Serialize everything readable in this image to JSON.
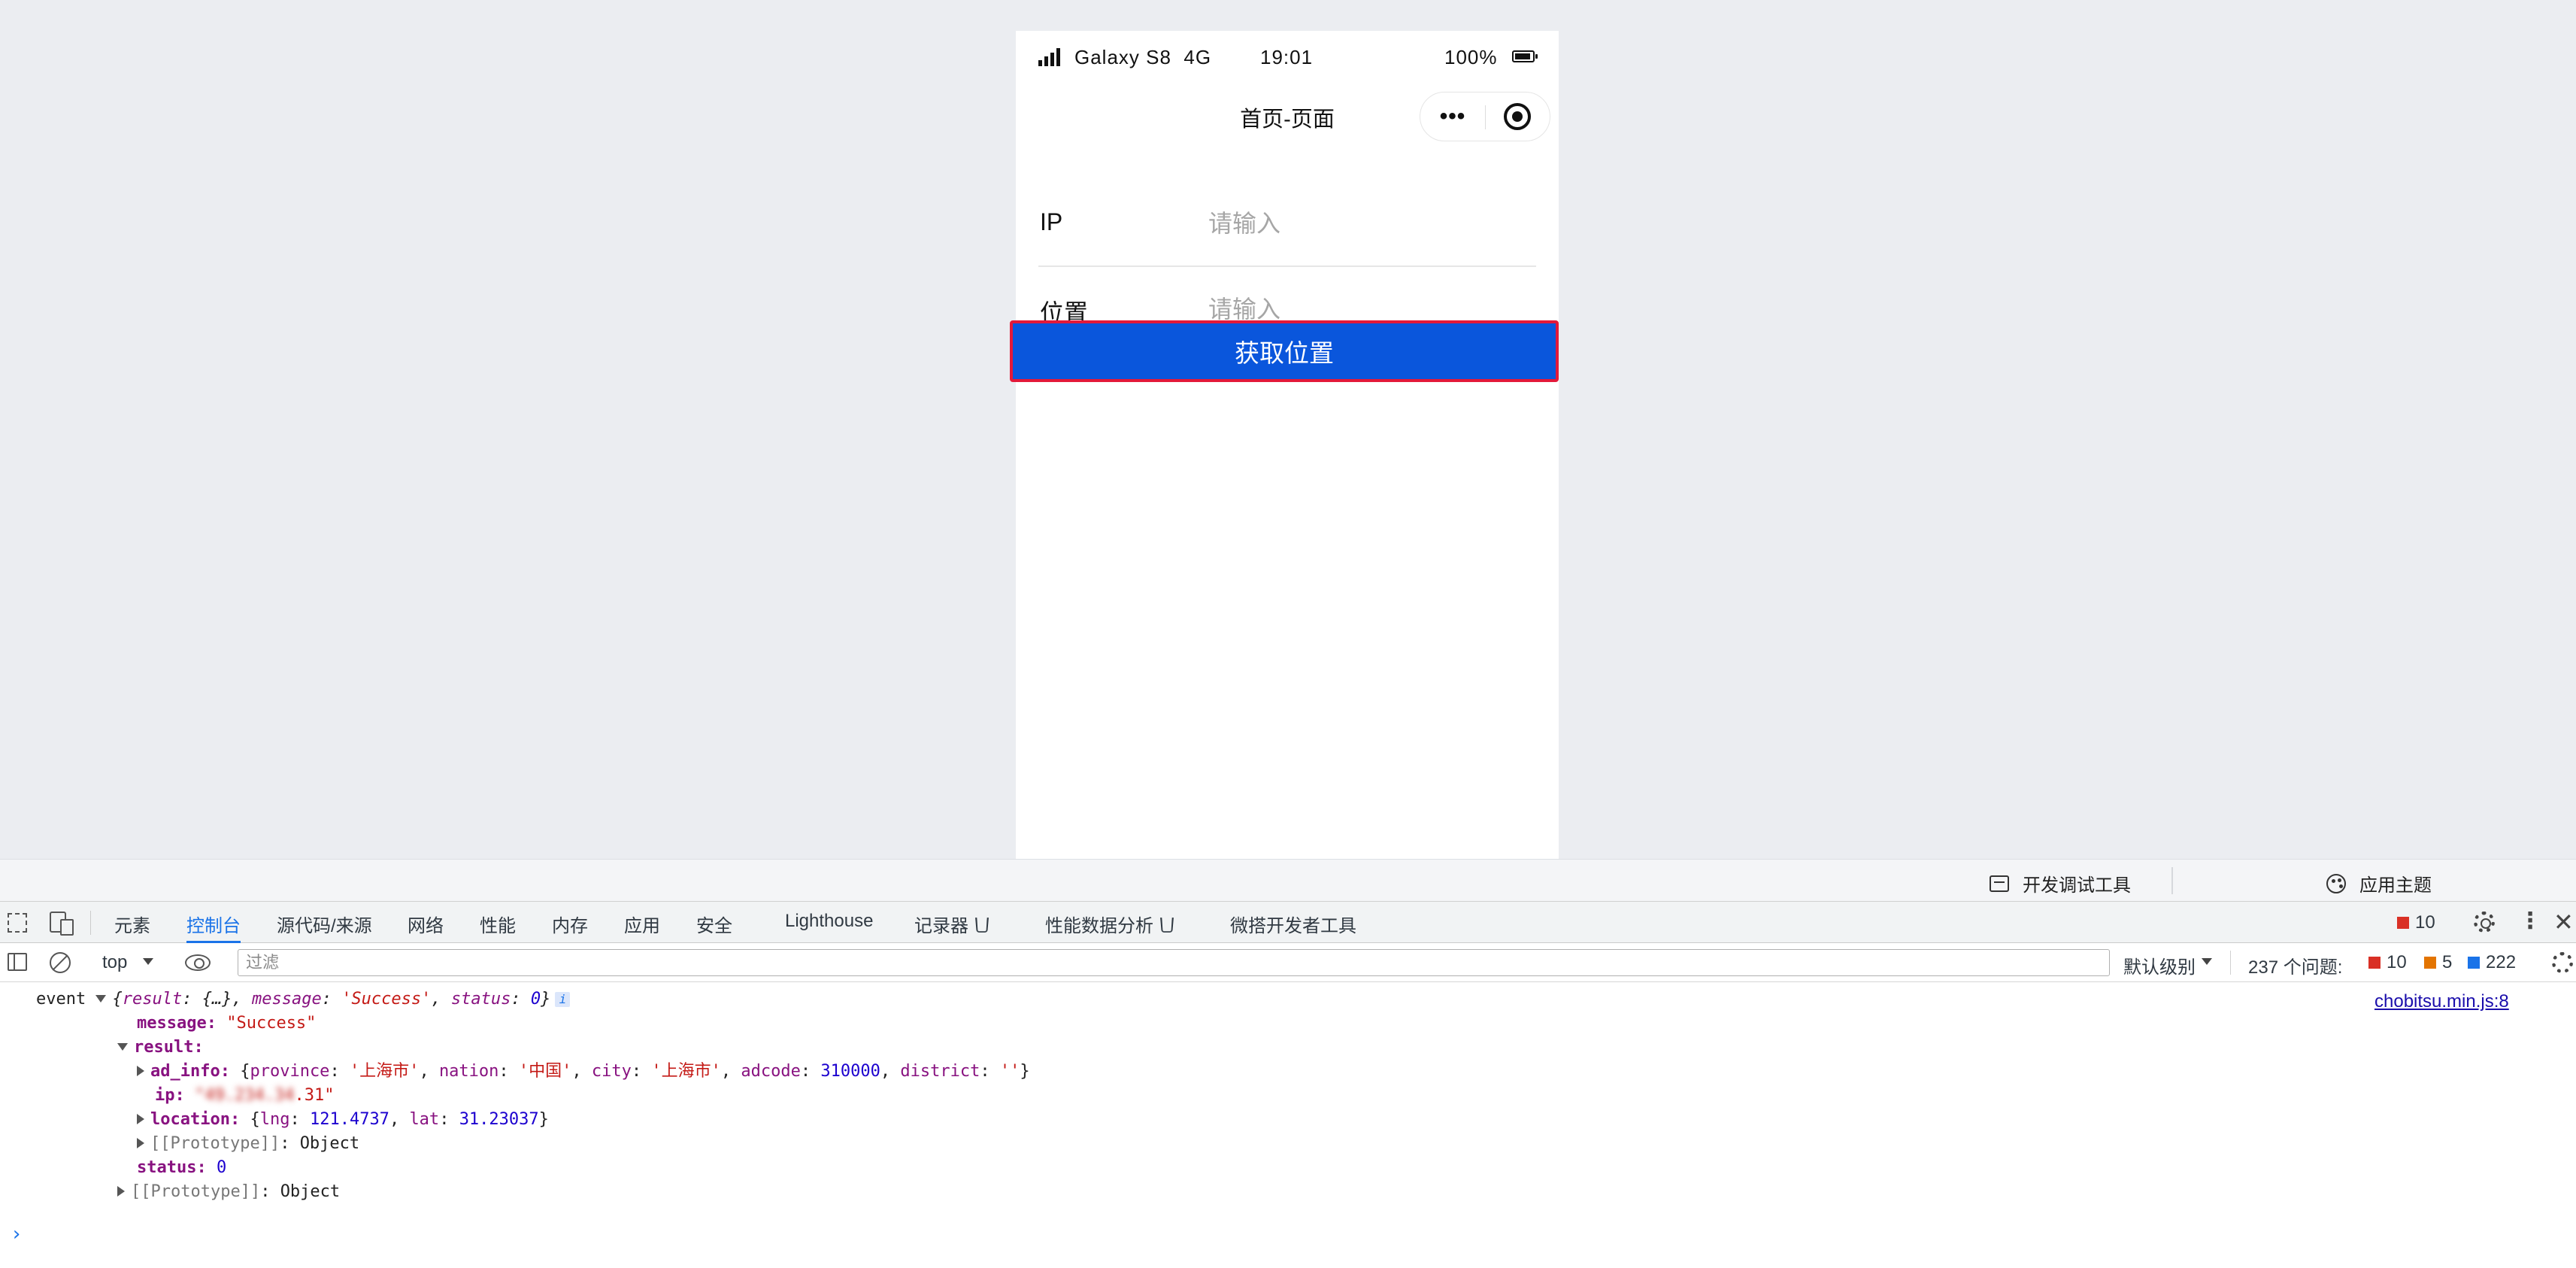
{
  "phone": {
    "status": {
      "carrier": "Galaxy S8",
      "network": "4G",
      "time": "19:01",
      "battery": "100%"
    },
    "nav_title": "首页-页面",
    "capsule": {
      "more": "•••"
    },
    "form": {
      "ip_label": "IP",
      "ip_placeholder": "请输入",
      "location_label": "位置",
      "location_placeholder": "请输入"
    },
    "button_label": "获取位置"
  },
  "tool_bar": {
    "debug_tools": "开发调试工具",
    "app_theme": "应用主题"
  },
  "devtools": {
    "tabs": [
      "元素",
      "控制台",
      "源代码/来源",
      "网络",
      "性能",
      "内存",
      "应用",
      "安全",
      "Lighthouse",
      "记录器",
      "性能数据分析",
      "微搭开发者工具"
    ],
    "active_tab": "控制台",
    "error_count": "10",
    "console_bar": {
      "context": "top",
      "filter_placeholder": "过滤",
      "levels": "默认级别",
      "issues": "237 个问题:",
      "errors": "10",
      "warnings": "5",
      "infos": "222"
    }
  },
  "console": {
    "source_link": "chobitsu.min.js:8",
    "label": "event",
    "summary": {
      "result": "{…}",
      "message": "'Success'",
      "status": "0"
    },
    "message_key": "message",
    "message_val": "\"Success\"",
    "result_key": "result",
    "ad_info_key": "ad_info",
    "ad_info": {
      "province": "'上海市'",
      "nation": "'中国'",
      "city": "'上海市'",
      "adcode": "310000",
      "district": "''"
    },
    "ip_key": "ip",
    "ip_masked": "\"49.234.34",
    "ip_tail": ".31\"",
    "location_key": "location",
    "location": {
      "lng": "121.4737",
      "lat": "31.23037"
    },
    "prototype_key": "[[Prototype]]",
    "prototype_val": "Object",
    "status_key": "status",
    "status_val": "0"
  },
  "colors": {
    "primary_button": "#0a56dc",
    "button_outline": "#e3193a",
    "active_tab": "#1a73e8"
  }
}
